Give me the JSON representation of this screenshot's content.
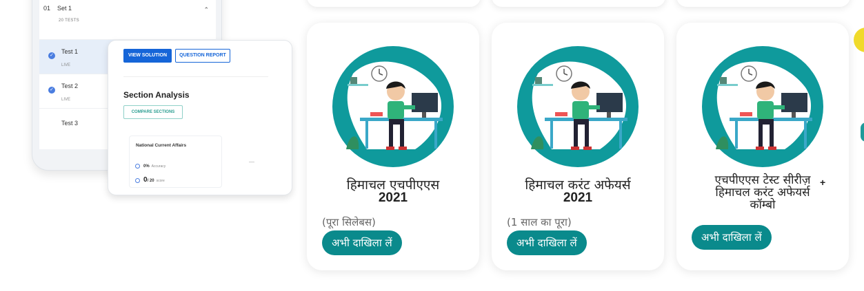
{
  "mockup": {
    "set": {
      "number": "01",
      "title": "Set 1",
      "subtitle": "20 TESTS",
      "chevron_icon": "chevron-up-icon"
    },
    "tests": [
      {
        "name": "Test 1",
        "status": "LIVE",
        "done": true,
        "active": true
      },
      {
        "name": "Test 2",
        "status": "LIVE",
        "done": true,
        "active": false
      },
      {
        "name": "Test 3",
        "status": "",
        "done": false,
        "active": false
      }
    ],
    "panel": {
      "view_solution": "VIEW SOLUTION",
      "question_report": "QUESTION REPORT",
      "section_title": "Section Analysis",
      "compare_sections": "COMPARE SECTIONS",
      "subject": "National Current Affairs",
      "accuracy_value": "0%",
      "accuracy_label": "Accuracy",
      "score_value": "0",
      "score_total": "/ 20",
      "score_label": "score"
    }
  },
  "courses": [
    {
      "title": "हिमाचल एचपीएएस",
      "year": "2021",
      "subtitle": "(पूरा सिलेबस)",
      "button": "अभी दाखिला लें"
    },
    {
      "title": "हिमाचल करंट अफेयर्स",
      "year": "2021",
      "subtitle": "(1 साल का पूरा)",
      "button": "अभी दाखिला लें"
    },
    {
      "title_lines": [
        "एचपीएएस टेस्ट सीरीज़",
        "हिमाचल करंट अफेयर्स",
        "कॉम्बो"
      ],
      "plus": "+",
      "button": "अभी दाखिला लें"
    }
  ],
  "colors": {
    "accent_teal": "#0a8a8c",
    "primary_blue": "#1565d8",
    "circle_teal": "#0f9a9c",
    "highlight_yellow": "#f0da2a"
  }
}
